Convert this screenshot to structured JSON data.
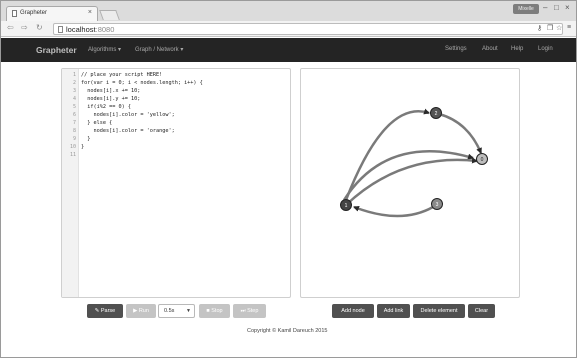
{
  "browser": {
    "tab_title": "Grapheter",
    "tab_close": "×",
    "user_button": "Mixelle",
    "url_host": "localhost",
    "url_port": ":8080"
  },
  "navbar": {
    "brand": "Grapheter",
    "algorithms": "Algorithms ▾",
    "graph_network": "Graph / Network ▾",
    "settings": "Settings",
    "about": "About",
    "help": "Help",
    "login": "Login"
  },
  "editor": {
    "lines": [
      "// place your script HERE!",
      "for(var i = 0; i < nodes.length; i++) {",
      "  nodes[i].x += 10;",
      "  nodes[i].y += 10;",
      "  if(i%2 == 0) {",
      "    nodes[i].color = 'yellow';",
      "  } else {",
      "    nodes[i].color = 'orange';",
      "  }",
      "}",
      ""
    ],
    "line_numbers": [
      "1",
      "2",
      "3",
      "4",
      "5",
      "6",
      "7",
      "8",
      "9",
      "10",
      "11"
    ]
  },
  "graph": {
    "nodes": [
      {
        "id": "n0",
        "label": "0",
        "fill": "#bdbdbd"
      },
      {
        "id": "n1",
        "label": "1",
        "fill": "#444444"
      },
      {
        "id": "n2",
        "label": "2",
        "fill": "#555555"
      },
      {
        "id": "n3",
        "label": "3",
        "fill": "#8a8a8a"
      }
    ]
  },
  "controls": {
    "parse": "✎ Parse",
    "run": "▶ Run",
    "speed": "0.5s",
    "speed_caret": "▼",
    "stop": "■ Stop",
    "step": "⏭ Step",
    "add_node": "Add node",
    "add_link": "Add link",
    "delete_element": "Delete element",
    "clear": "Clear"
  },
  "footer": {
    "copyright": "Copyright © Kamil Dareuch 2015"
  },
  "colors": {
    "navbar_bg": "#242424",
    "button_dark": "#505050",
    "button_light": "#c4c4c4",
    "edge": "#7a7a7a"
  }
}
